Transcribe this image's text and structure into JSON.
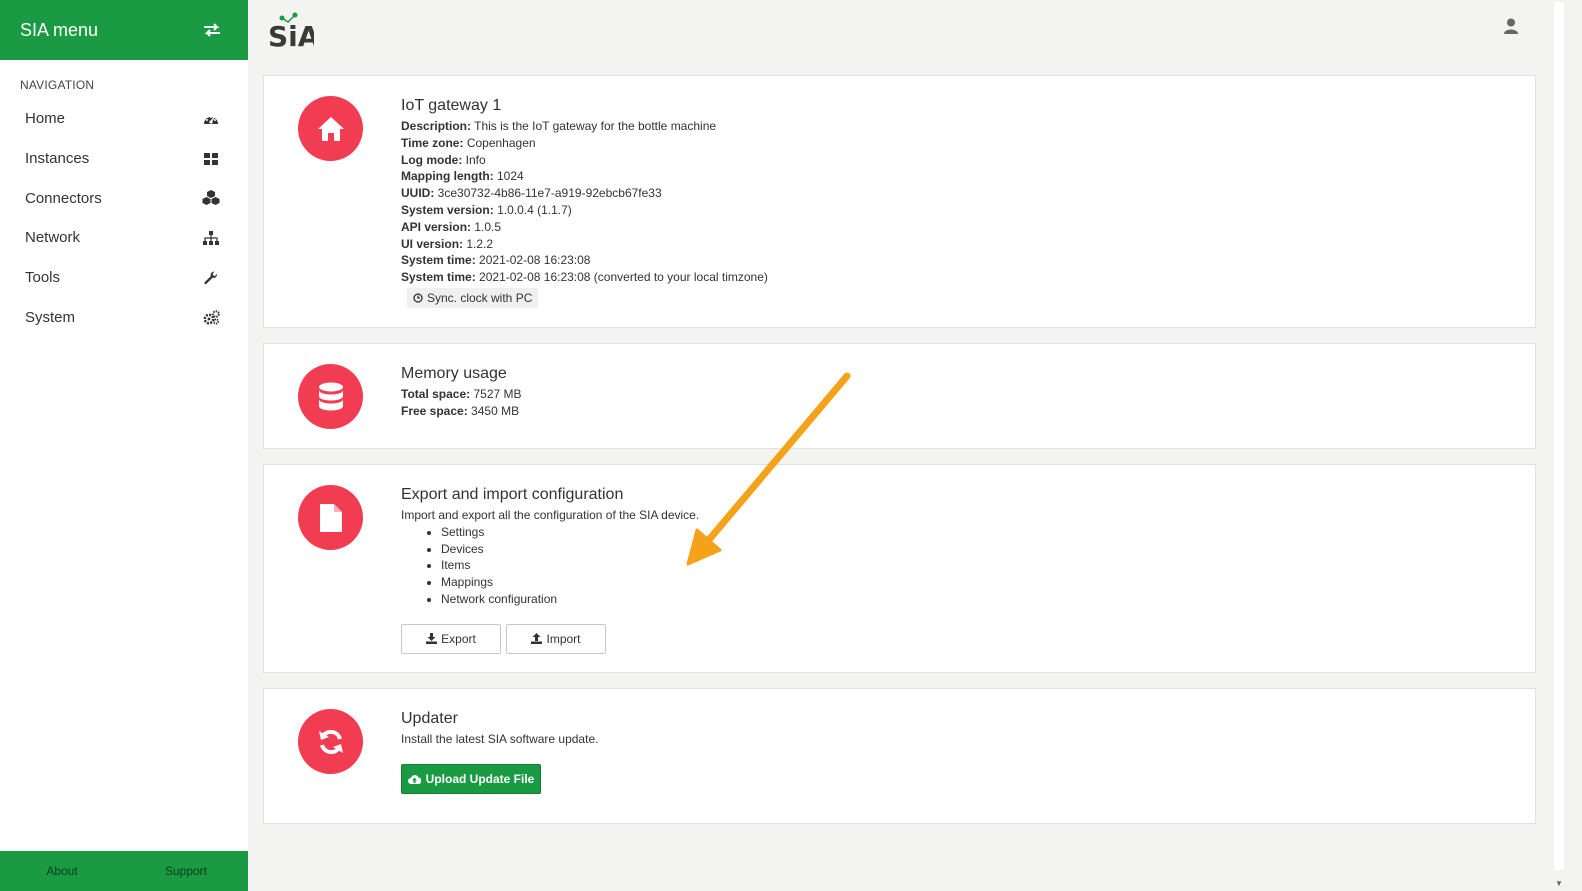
{
  "sidebar": {
    "title": "SIA menu",
    "nav_heading": "NAVIGATION",
    "items": [
      {
        "label": "Home",
        "icon": "dashboard-icon"
      },
      {
        "label": "Instances",
        "icon": "grid-icon"
      },
      {
        "label": "Connectors",
        "icon": "cubes-icon"
      },
      {
        "label": "Network",
        "icon": "sitemap-icon"
      },
      {
        "label": "Tools",
        "icon": "wrench-icon"
      },
      {
        "label": "System",
        "icon": "gears-icon"
      }
    ],
    "footer": {
      "about": "About",
      "support": "Support"
    }
  },
  "header": {
    "logo_text": "SiA"
  },
  "gateway": {
    "title": "IoT gateway 1",
    "fields": [
      {
        "label": "Description:",
        "value": "This is the IoT gateway for the bottle machine"
      },
      {
        "label": "Time zone:",
        "value": "Copenhagen"
      },
      {
        "label": "Log mode:",
        "value": "Info"
      },
      {
        "label": "Mapping length:",
        "value": "1024"
      },
      {
        "label": "UUID:",
        "value": "3ce30732-4b86-11e7-a919-92ebcb67fe33"
      },
      {
        "label": "System version:",
        "value": "1.0.0.4 (1.1.7)"
      },
      {
        "label": "API version:",
        "value": "1.0.5"
      },
      {
        "label": "UI version:",
        "value": "1.2.2"
      },
      {
        "label": "System time:",
        "value": "2021-02-08 16:23:08"
      },
      {
        "label": "System time:",
        "value": "2021-02-08 16:23:08 (converted to your local timzone)"
      }
    ],
    "sync_button": "Sync. clock with PC"
  },
  "memory": {
    "title": "Memory usage",
    "fields": [
      {
        "label": "Total space:",
        "value": "7527 MB"
      },
      {
        "label": "Free space:",
        "value": "3450 MB"
      }
    ]
  },
  "config": {
    "title": "Export and import configuration",
    "description": "Import and export all the configuration of the SIA device.",
    "items": [
      "Settings",
      "Devices",
      "Items",
      "Mappings",
      "Network configuration"
    ],
    "export_button": "Export",
    "import_button": "Import"
  },
  "updater": {
    "title": "Updater",
    "description": "Install the latest SIA software update.",
    "upload_button": "Upload Update File"
  },
  "colors": {
    "brand_green": "#1a9a43",
    "icon_red": "#f23c52",
    "annotation_arrow": "#f5a21b"
  }
}
